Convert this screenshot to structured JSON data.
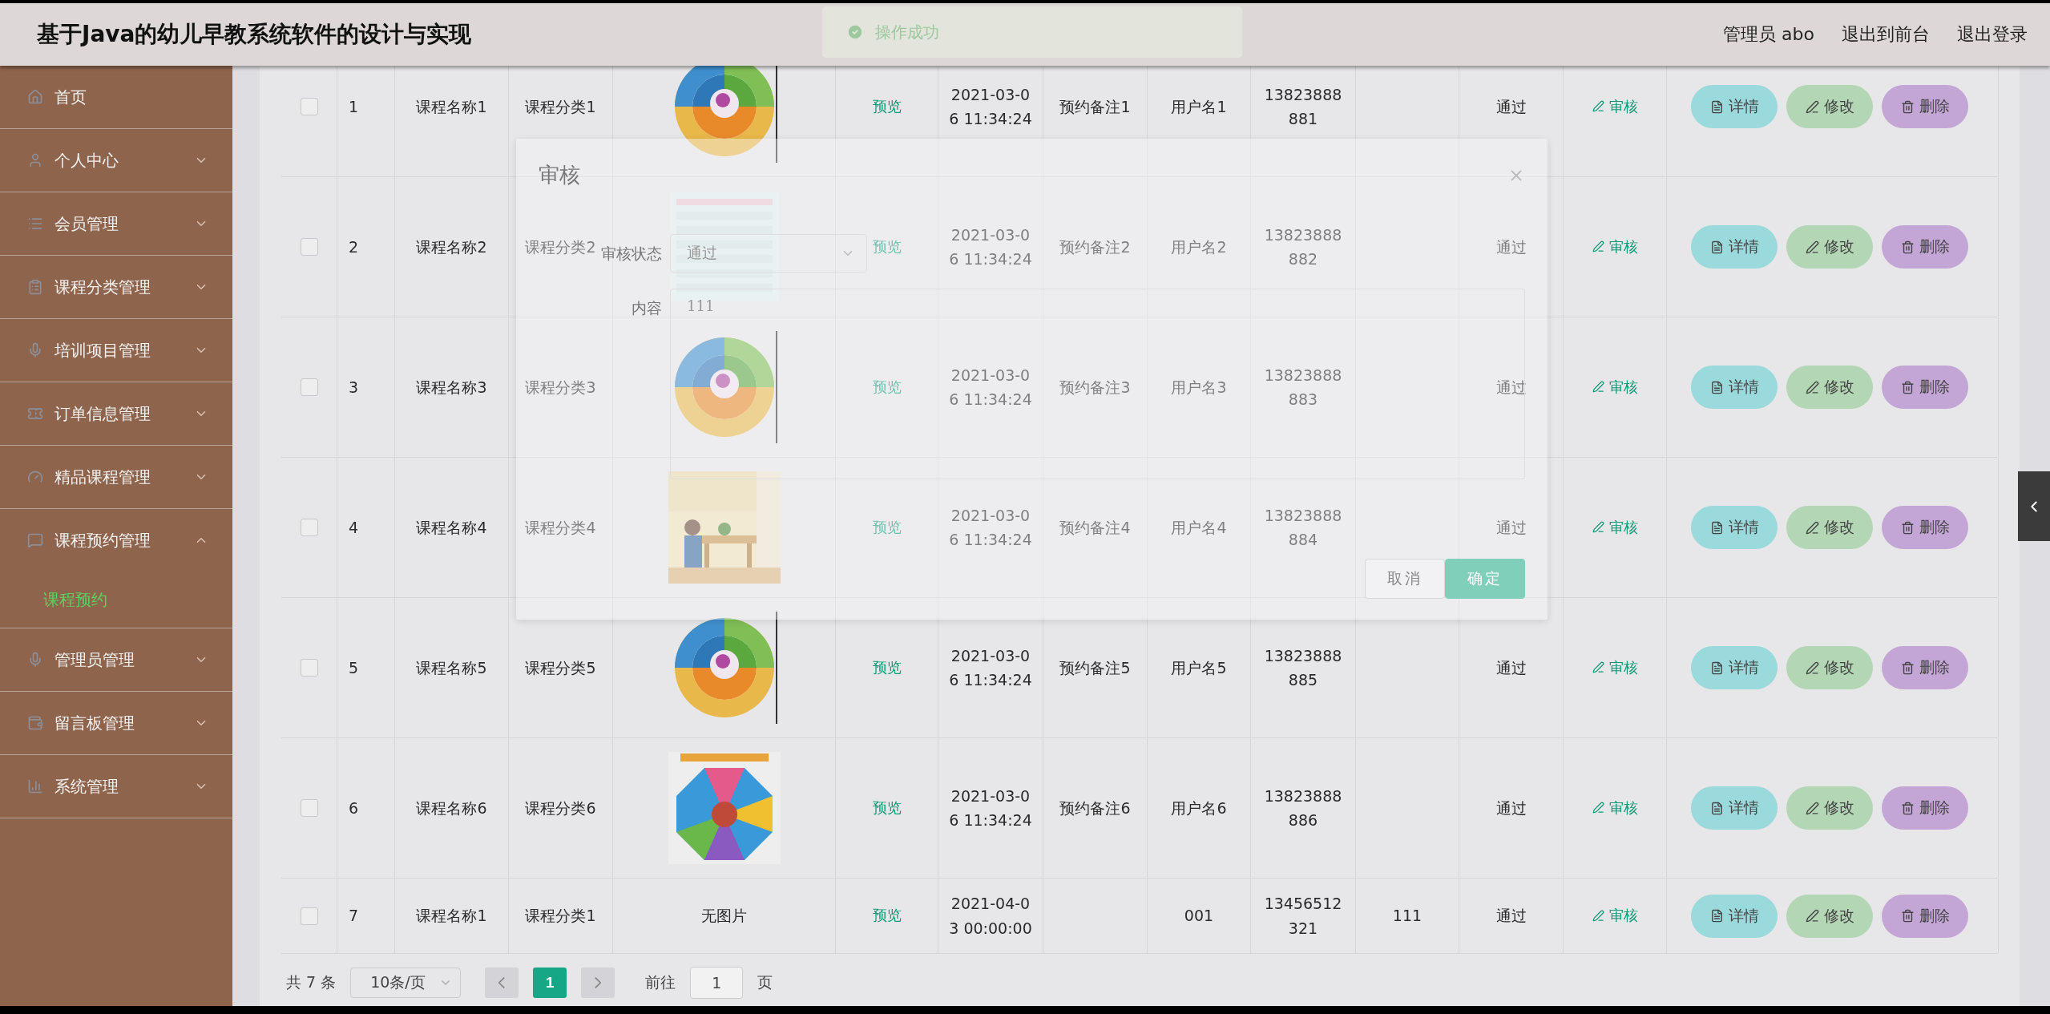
{
  "header": {
    "title": "基于Java的幼儿早教系统软件的设计与实现",
    "links": [
      "管理员 abo",
      "退出到前台",
      "退出登录"
    ]
  },
  "toast": {
    "text": "操作成功"
  },
  "sidebar": {
    "items": [
      {
        "label": "首页"
      },
      {
        "label": "个人中心",
        "expandable": true,
        "expanded": false
      },
      {
        "label": "会员管理",
        "expandable": true,
        "expanded": false
      },
      {
        "label": "课程分类管理",
        "expandable": true,
        "expanded": false
      },
      {
        "label": "培训项目管理",
        "expandable": true,
        "expanded": false
      },
      {
        "label": "订单信息管理",
        "expandable": true,
        "expanded": false
      },
      {
        "label": "精品课程管理",
        "expandable": true,
        "expanded": false
      },
      {
        "label": "课程预约管理",
        "expandable": true,
        "expanded": true,
        "children": [
          {
            "label": "课程预约",
            "selected": true
          }
        ]
      },
      {
        "label": "管理员管理",
        "expandable": true,
        "expanded": false
      },
      {
        "label": "留言板管理",
        "expandable": true,
        "expanded": false
      },
      {
        "label": "系统管理",
        "expandable": true,
        "expanded": false
      }
    ]
  },
  "table": {
    "rows": [
      {
        "checked": false,
        "index": "1",
        "name": "课程名称1",
        "category": "课程分类1",
        "preview": "预览",
        "time": "2021-03-06 11:34:24",
        "remark": "预约备注1",
        "user": "用户名1",
        "phone": "13823888881",
        "status": "通过",
        "audit": "审核",
        "actions": [
          "详情",
          "修改",
          "删除"
        ]
      },
      {
        "checked": false,
        "index": "2",
        "name": "课程名称2",
        "category": "课程分类2",
        "preview": "预览",
        "time": "2021-03-06 11:34:24",
        "remark": "预约备注2",
        "user": "用户名2",
        "phone": "13823888882",
        "status": "通过",
        "audit": "审核",
        "actions": [
          "详情",
          "修改",
          "删除"
        ]
      },
      {
        "checked": false,
        "index": "3",
        "name": "课程名称3",
        "category": "课程分类3",
        "preview": "预览",
        "time": "2021-03-06 11:34:24",
        "remark": "预约备注3",
        "user": "用户名3",
        "phone": "13823888883",
        "status": "通过",
        "audit": "审核",
        "actions": [
          "详情",
          "修改",
          "删除"
        ]
      },
      {
        "checked": false,
        "index": "4",
        "name": "课程名称4",
        "category": "课程分类4",
        "preview": "预览",
        "time": "2021-03-06 11:34:24",
        "remark": "预约备注4",
        "user": "用户名4",
        "phone": "13823888884",
        "status": "通过",
        "audit": "审核",
        "actions": [
          "详情",
          "修改",
          "删除"
        ]
      },
      {
        "checked": false,
        "index": "5",
        "name": "课程名称5",
        "category": "课程分类5",
        "preview": "预览",
        "time": "2021-03-06 11:34:24",
        "remark": "预约备注5",
        "user": "用户名5",
        "phone": "13823888885",
        "status": "通过",
        "audit": "审核",
        "actions": [
          "详情",
          "修改",
          "删除"
        ]
      },
      {
        "checked": false,
        "index": "6",
        "name": "课程名称6",
        "category": "课程分类6",
        "preview": "预览",
        "time": "2021-03-06 11:34:24",
        "remark": "预约备注6",
        "user": "用户名6",
        "phone": "13823888886",
        "status": "通过",
        "audit": "审核",
        "actions": [
          "详情",
          "修改",
          "删除"
        ]
      },
      {
        "checked": false,
        "index": "7",
        "name": "课程名称1",
        "category": "课程分类1",
        "image": {
          "kind": "text",
          "text": "无图片"
        },
        "preview": "预览",
        "time": "2021-04-03 00:00:00",
        "user": "001",
        "phone": "13456512321",
        "column_11": "111",
        "status": "通过",
        "audit": "审核",
        "actions": [
          "详情",
          "修改",
          "删除"
        ]
      }
    ]
  },
  "pagination": {
    "total": "共 7 条",
    "page_size": "10条/页",
    "pages": [
      {
        "label": "1",
        "selected": true
      }
    ],
    "goto_label": "前往",
    "goto_value": "1",
    "goto_suffix": "页"
  },
  "dialog": {
    "title": "审核",
    "fields": [
      {
        "kind": "select",
        "label": "审核状态",
        "value": "通过"
      },
      {
        "kind": "textarea",
        "label": "内容",
        "value": "111"
      }
    ],
    "buttons": [
      {
        "label": "取消",
        "primary": false
      },
      {
        "label": "确定",
        "primary": true
      }
    ]
  }
}
